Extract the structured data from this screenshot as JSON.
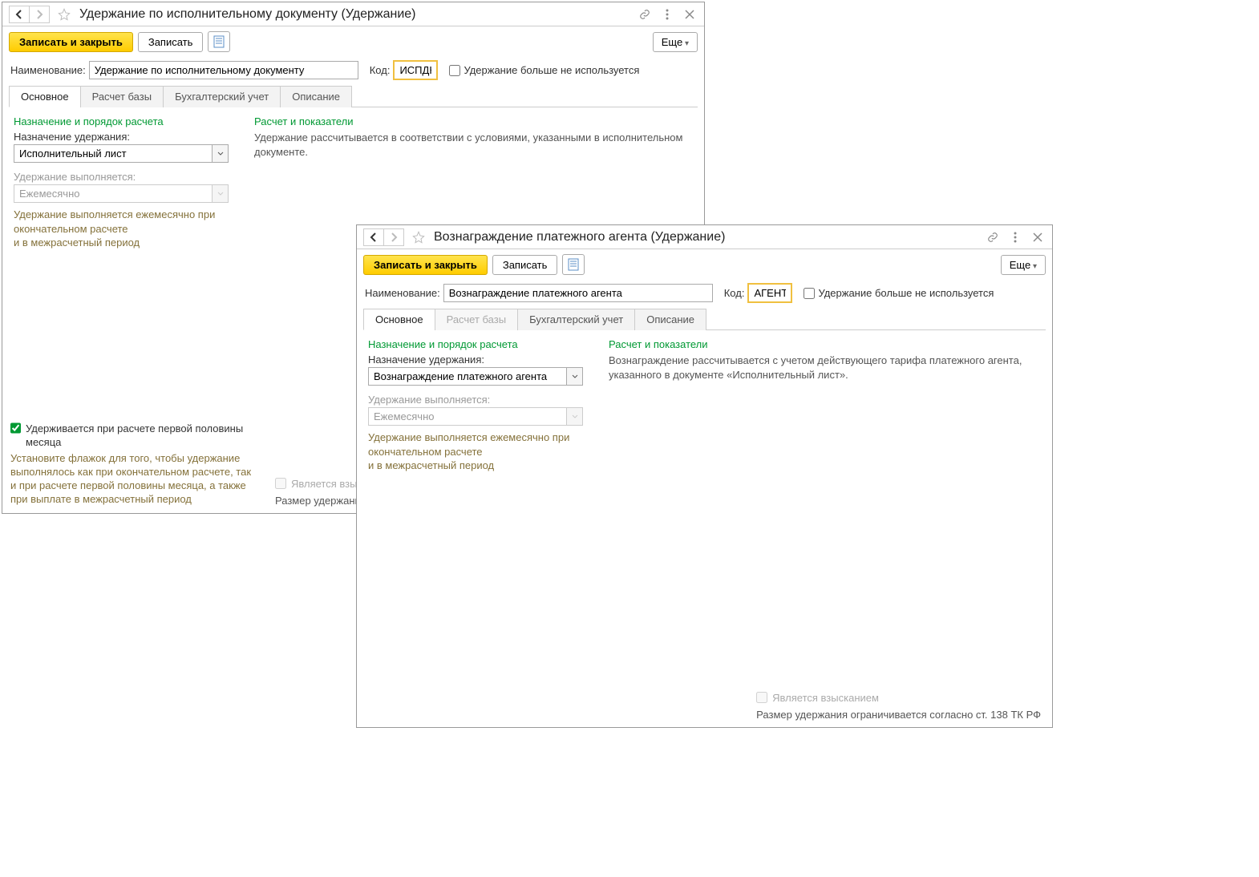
{
  "win1": {
    "title": "Удержание по исполнительному документу (Удержание)",
    "save_close": "Записать и закрыть",
    "save": "Записать",
    "more": "Еще",
    "name_label": "Наименование:",
    "name_value": "Удержание по исполнительному документу",
    "code_label": "Код:",
    "code_value": "ИСПДК",
    "not_used_label": "Удержание больше не используется",
    "tabs": [
      "Основное",
      "Расчет базы",
      "Бухгалтерский учет",
      "Описание"
    ],
    "left_header": "Назначение и порядок расчета",
    "purpose_label": "Назначение удержания:",
    "purpose_value": "Исполнительный лист",
    "freq_label": "Удержание выполняется:",
    "freq_value": "Ежемесячно",
    "freq_info": "Удержание выполняется ежемесячно при окончательном расчете\nи в межрасчетный период",
    "right_header": "Расчет и показатели",
    "right_desc": "Удержание рассчитывается в соответствии с условиями, указанными в исполнительном документе.",
    "first_half_label": "Удерживается при расчете первой половины месяца",
    "first_half_hint": "Установите флажок для того, чтобы удержание выполнялось как при окончательном расчете, так и при расчете первой половины месяца, а также при выплате в межрасчетный период",
    "is_penalty_label": "Является взысканием",
    "limit_label": "Размер удержания ограничи"
  },
  "win2": {
    "title": "Вознаграждение платежного агента (Удержание)",
    "save_close": "Записать и закрыть",
    "save": "Записать",
    "more": "Еще",
    "name_label": "Наименование:",
    "name_value": "Вознаграждение платежного агента",
    "code_label": "Код:",
    "code_value": "АГЕНТ",
    "not_used_label": "Удержание больше не используется",
    "tabs": [
      "Основное",
      "Расчет базы",
      "Бухгалтерский учет",
      "Описание"
    ],
    "left_header": "Назначение и порядок расчета",
    "purpose_label": "Назначение удержания:",
    "purpose_value": "Вознаграждение платежного агента",
    "freq_label": "Удержание выполняется:",
    "freq_value": "Ежемесячно",
    "freq_info": "Удержание выполняется ежемесячно при окончательном расчете\nи в межрасчетный период",
    "right_header": "Расчет и показатели",
    "right_desc": "Вознаграждение рассчитывается с учетом действующего тарифа платежного агента, указанного в документе «Исполнительный лист».",
    "is_penalty_label": "Является взысканием",
    "limit_label": "Размер удержания ограничивается согласно ст. 138 ТК РФ"
  }
}
